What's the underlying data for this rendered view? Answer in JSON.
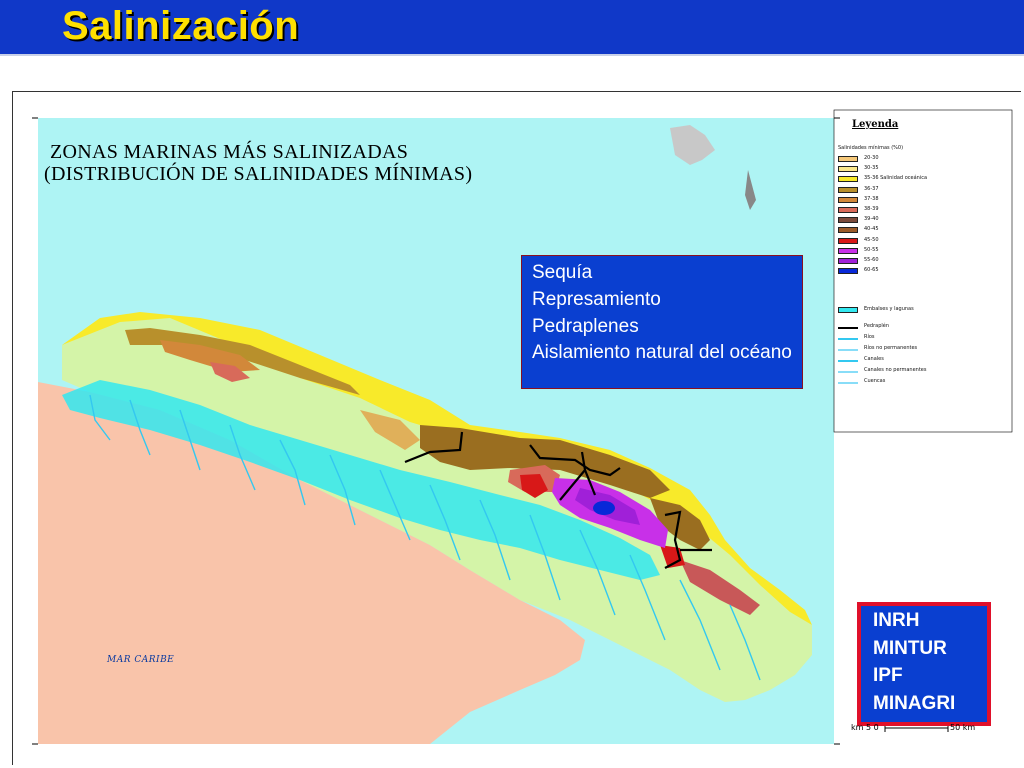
{
  "slide": {
    "title": "Salinización"
  },
  "map": {
    "heading_line1": "ZONAS MARINAS MÁS SALINIZADAS",
    "heading_line2": "(DISTRIBUCIÓN DE SALINIDADES MÍNIMAS)",
    "sea_label": "MAR CARIBE",
    "scale_left": "km 5 0",
    "scale_right": "50 km"
  },
  "legend": {
    "heading": "Leyenda",
    "subheading": "Salinidades mínimas (%0)",
    "salinity_classes": [
      {
        "label": "20-30",
        "color": "#f6c97a"
      },
      {
        "label": "30-35",
        "color": "#fbe88c"
      },
      {
        "label": "35-36 Salinidad oceánica",
        "color": "#f8ea2a"
      },
      {
        "label": "36-37",
        "color": "#b8902c"
      },
      {
        "label": "37-38",
        "color": "#d2883a"
      },
      {
        "label": "38-39",
        "color": "#d86a5a"
      },
      {
        "label": "39-40",
        "color": "#7a4a3a"
      },
      {
        "label": "40-45",
        "color": "#9a5a28"
      },
      {
        "label": "45-50",
        "color": "#d81818"
      },
      {
        "label": "50-55",
        "color": "#c830e8"
      },
      {
        "label": "55-60",
        "color": "#a020d8"
      },
      {
        "label": "60-65",
        "color": "#0828d8"
      }
    ],
    "features": [
      {
        "label": "Embalses y lagunas",
        "kind": "swatch",
        "color": "#33e8f0"
      },
      {
        "label": "Pedraplén",
        "kind": "line",
        "color": "#000000"
      },
      {
        "label": "Ríos",
        "kind": "line",
        "color": "#33c8f0"
      },
      {
        "label": "Ríos no permanentes",
        "kind": "line",
        "color": "#88ddf8"
      },
      {
        "label": "Canales",
        "kind": "line",
        "color": "#33c8f0"
      },
      {
        "label": "Canales no permanentes",
        "kind": "line",
        "color": "#88ddf8"
      },
      {
        "label": "Cuencas",
        "kind": "line",
        "color": "#88ddf8"
      }
    ]
  },
  "causes": [
    "Sequía",
    "Represamiento",
    "Pedraplenes",
    "Aislamiento natural del océano"
  ],
  "organizations": [
    "INRH",
    "MINTUR",
    "IPF",
    "MINAGRI"
  ],
  "colors": {
    "title_bar": "#1038c8",
    "title_text": "#ffe000",
    "sea": "#aef4f4",
    "land_south": "#f9c4aa",
    "island": "#d4f4a8",
    "reservoirs": "#33e8f0",
    "box_fill": "#0a3fd0",
    "org_border": "#e0102a"
  }
}
